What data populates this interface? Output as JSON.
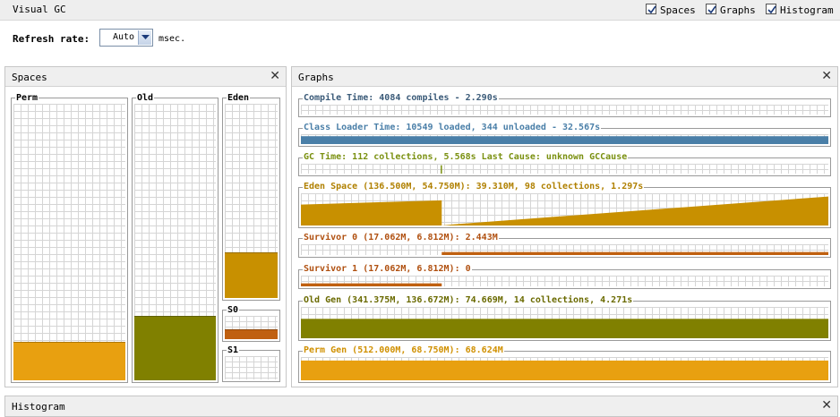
{
  "window": {
    "title": "Visual GC",
    "checkboxes": [
      {
        "label": "Spaces",
        "checked": true
      },
      {
        "label": "Graphs",
        "checked": true
      },
      {
        "label": "Histogram",
        "checked": true
      }
    ]
  },
  "refresh": {
    "label": "Refresh rate:",
    "value": "Auto",
    "unit": "msec."
  },
  "spaces_panel": {
    "title": "Spaces",
    "spaces": [
      {
        "label": "Perm",
        "fill_fraction": 0.135,
        "color": "#e8a010"
      },
      {
        "label": "Old",
        "fill_fraction": 0.23,
        "color": "#808000"
      },
      {
        "label": "Eden",
        "fill_fraction": 0.23,
        "color": "#c89000"
      },
      {
        "label": "S0",
        "fill_fraction": 0.4,
        "color": "#c06010"
      },
      {
        "label": "S1",
        "fill_fraction": 0.0,
        "color": "#c06010"
      }
    ]
  },
  "graphs_panel": {
    "title": "Graphs",
    "graphs": [
      {
        "label": "Compile Time: 4084 compiles - 2.290s",
        "color": "#3a5a78",
        "kind": "empty"
      },
      {
        "label": "Class Loader Time: 10549 loaded, 344 unloaded - 32.567s",
        "color": "#4a7fa8",
        "kind": "full"
      },
      {
        "label": "GC Time: 112 collections, 5.568s  Last Cause: unknown GCCause",
        "color": "#7a9010",
        "kind": "spike"
      },
      {
        "label": "Eden Space (136.500M, 54.750M): 39.310M, 98 collections, 1.297s",
        "color": "#c89000",
        "kind": "eden"
      },
      {
        "label": "Survivor 0 (17.062M, 6.812M): 2.443M",
        "color": "#c06010",
        "kind": "s0"
      },
      {
        "label": "Survivor 1 (17.062M, 6.812M): 0",
        "color": "#c06010",
        "kind": "s1"
      },
      {
        "label": "Old Gen (341.375M, 136.672M): 74.669M, 14 collections, 4.271s",
        "color": "#808000",
        "kind": "old"
      },
      {
        "label": "Perm Gen (512.000M, 68.750M): 68.624M",
        "color": "#e8a010",
        "kind": "perm"
      }
    ]
  },
  "histogram_panel": {
    "title": "Histogram"
  },
  "icons": {
    "close": "close-icon",
    "checkbox": "checkmark-icon",
    "dropdown": "chevron-down-icon"
  }
}
